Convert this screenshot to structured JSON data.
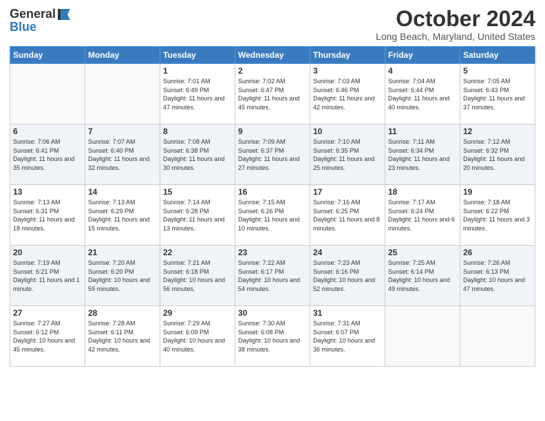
{
  "header": {
    "logo_general": "General",
    "logo_blue": "Blue",
    "month_title": "October 2024",
    "location": "Long Beach, Maryland, United States"
  },
  "days_of_week": [
    "Sunday",
    "Monday",
    "Tuesday",
    "Wednesday",
    "Thursday",
    "Friday",
    "Saturday"
  ],
  "weeks": [
    [
      {
        "day": "",
        "info": ""
      },
      {
        "day": "",
        "info": ""
      },
      {
        "day": "1",
        "info": "Sunrise: 7:01 AM\nSunset: 6:49 PM\nDaylight: 11 hours and 47 minutes."
      },
      {
        "day": "2",
        "info": "Sunrise: 7:02 AM\nSunset: 6:47 PM\nDaylight: 11 hours and 45 minutes."
      },
      {
        "day": "3",
        "info": "Sunrise: 7:03 AM\nSunset: 6:46 PM\nDaylight: 11 hours and 42 minutes."
      },
      {
        "day": "4",
        "info": "Sunrise: 7:04 AM\nSunset: 6:44 PM\nDaylight: 11 hours and 40 minutes."
      },
      {
        "day": "5",
        "info": "Sunrise: 7:05 AM\nSunset: 6:43 PM\nDaylight: 11 hours and 37 minutes."
      }
    ],
    [
      {
        "day": "6",
        "info": "Sunrise: 7:06 AM\nSunset: 6:41 PM\nDaylight: 11 hours and 35 minutes."
      },
      {
        "day": "7",
        "info": "Sunrise: 7:07 AM\nSunset: 6:40 PM\nDaylight: 11 hours and 32 minutes."
      },
      {
        "day": "8",
        "info": "Sunrise: 7:08 AM\nSunset: 6:38 PM\nDaylight: 11 hours and 30 minutes."
      },
      {
        "day": "9",
        "info": "Sunrise: 7:09 AM\nSunset: 6:37 PM\nDaylight: 11 hours and 27 minutes."
      },
      {
        "day": "10",
        "info": "Sunrise: 7:10 AM\nSunset: 6:35 PM\nDaylight: 11 hours and 25 minutes."
      },
      {
        "day": "11",
        "info": "Sunrise: 7:11 AM\nSunset: 6:34 PM\nDaylight: 11 hours and 23 minutes."
      },
      {
        "day": "12",
        "info": "Sunrise: 7:12 AM\nSunset: 6:32 PM\nDaylight: 11 hours and 20 minutes."
      }
    ],
    [
      {
        "day": "13",
        "info": "Sunrise: 7:13 AM\nSunset: 6:31 PM\nDaylight: 11 hours and 18 minutes."
      },
      {
        "day": "14",
        "info": "Sunrise: 7:13 AM\nSunset: 6:29 PM\nDaylight: 11 hours and 15 minutes."
      },
      {
        "day": "15",
        "info": "Sunrise: 7:14 AM\nSunset: 6:28 PM\nDaylight: 11 hours and 13 minutes."
      },
      {
        "day": "16",
        "info": "Sunrise: 7:15 AM\nSunset: 6:26 PM\nDaylight: 11 hours and 10 minutes."
      },
      {
        "day": "17",
        "info": "Sunrise: 7:16 AM\nSunset: 6:25 PM\nDaylight: 11 hours and 8 minutes."
      },
      {
        "day": "18",
        "info": "Sunrise: 7:17 AM\nSunset: 6:24 PM\nDaylight: 11 hours and 6 minutes."
      },
      {
        "day": "19",
        "info": "Sunrise: 7:18 AM\nSunset: 6:22 PM\nDaylight: 11 hours and 3 minutes."
      }
    ],
    [
      {
        "day": "20",
        "info": "Sunrise: 7:19 AM\nSunset: 6:21 PM\nDaylight: 11 hours and 1 minute."
      },
      {
        "day": "21",
        "info": "Sunrise: 7:20 AM\nSunset: 6:20 PM\nDaylight: 10 hours and 59 minutes."
      },
      {
        "day": "22",
        "info": "Sunrise: 7:21 AM\nSunset: 6:18 PM\nDaylight: 10 hours and 56 minutes."
      },
      {
        "day": "23",
        "info": "Sunrise: 7:22 AM\nSunset: 6:17 PM\nDaylight: 10 hours and 54 minutes."
      },
      {
        "day": "24",
        "info": "Sunrise: 7:23 AM\nSunset: 6:16 PM\nDaylight: 10 hours and 52 minutes."
      },
      {
        "day": "25",
        "info": "Sunrise: 7:25 AM\nSunset: 6:14 PM\nDaylight: 10 hours and 49 minutes."
      },
      {
        "day": "26",
        "info": "Sunrise: 7:26 AM\nSunset: 6:13 PM\nDaylight: 10 hours and 47 minutes."
      }
    ],
    [
      {
        "day": "27",
        "info": "Sunrise: 7:27 AM\nSunset: 6:12 PM\nDaylight: 10 hours and 45 minutes."
      },
      {
        "day": "28",
        "info": "Sunrise: 7:28 AM\nSunset: 6:11 PM\nDaylight: 10 hours and 42 minutes."
      },
      {
        "day": "29",
        "info": "Sunrise: 7:29 AM\nSunset: 6:09 PM\nDaylight: 10 hours and 40 minutes."
      },
      {
        "day": "30",
        "info": "Sunrise: 7:30 AM\nSunset: 6:08 PM\nDaylight: 10 hours and 38 minutes."
      },
      {
        "day": "31",
        "info": "Sunrise: 7:31 AM\nSunset: 6:07 PM\nDaylight: 10 hours and 36 minutes."
      },
      {
        "day": "",
        "info": ""
      },
      {
        "day": "",
        "info": ""
      }
    ]
  ]
}
